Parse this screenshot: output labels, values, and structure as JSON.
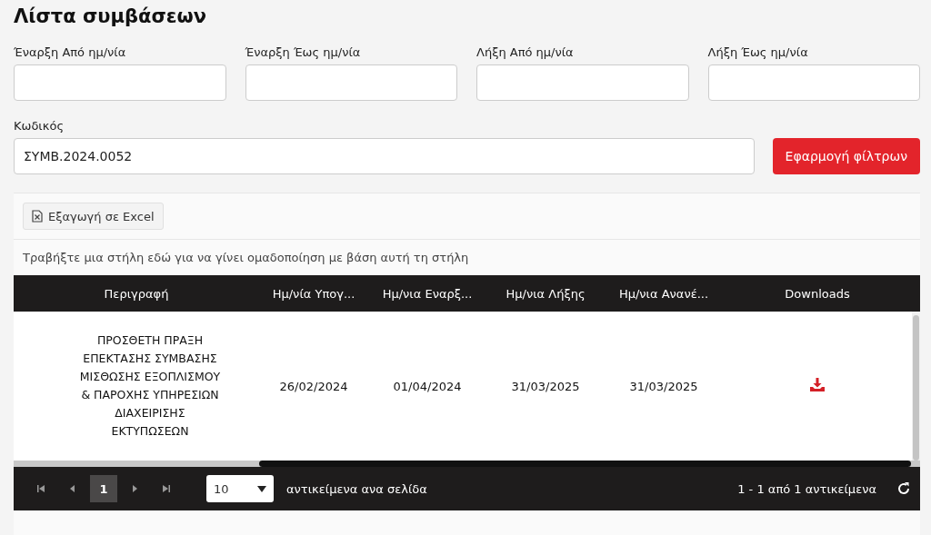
{
  "title": "Λίστα συμβάσεων",
  "date_filters": [
    {
      "label": "Έναρξη Από ημ/νία"
    },
    {
      "label": "Έναρξη Έως ημ/νία"
    },
    {
      "label": "Λήξη Από ημ/νία"
    },
    {
      "label": "Λήξη Έως ημ/νία"
    }
  ],
  "code_filter": {
    "label": "Κωδικός",
    "value": "ΣΥΜΒ.2024.0052"
  },
  "apply_button": "Εφαρμογή φίλτρων",
  "export_button": "Εξαγωγή σε Excel",
  "group_hint": "Τραβήξτε μια στήλη εδώ για να γίνει ομαδοποίηση με βάση αυτή τη στήλη",
  "table": {
    "columns": [
      "Περιγραφή",
      "Ημ/νία Υπογ...",
      "Ημ/νια Εναρξ...",
      "Ημ/νια Λήξης",
      "Ημ/νια Ανανέ...",
      "Downloads"
    ],
    "rows": [
      {
        "cells": [
          "ΠΡΟΣΘΕΤΗ ΠΡΑΞΗ ΕΠΕΚΤΑΣΗΣ ΣΥΜΒΑΣΗΣ ΜΙΣΘΩΣΗΣ ΕΞΟΠΛΙΣΜΟΥ & ΠΑΡΟΧΗΣ ΥΠΗΡΕΣΙΩΝ ΔΙΑΧΕΙΡΙΣΗΣ ΕΚΤΥΠΩΣΕΩΝ",
          "26/02/2024",
          "01/04/2024",
          "31/03/2025",
          "31/03/2025"
        ],
        "download": true
      }
    ]
  },
  "pager": {
    "pages": [
      {
        "label": "1",
        "selected": true
      }
    ],
    "page_size": "10",
    "page_size_label": "αντικείμενα ανα σελίδα",
    "summary": "1 - 1 από 1 αντικείμενα"
  }
}
